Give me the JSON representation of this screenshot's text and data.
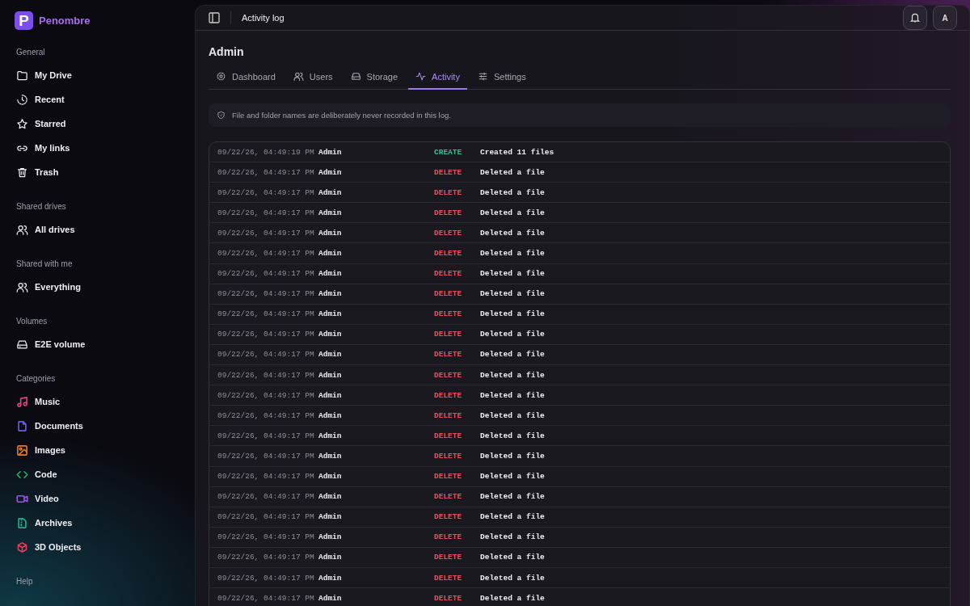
{
  "brand": {
    "name": "Penombre",
    "logo_letter": "P"
  },
  "sidebar": {
    "sections": [
      {
        "title": "General",
        "items": [
          {
            "label": "My Drive"
          },
          {
            "label": "Recent"
          },
          {
            "label": "Starred"
          },
          {
            "label": "My links"
          },
          {
            "label": "Trash"
          }
        ]
      },
      {
        "title": "Shared drives",
        "items": [
          {
            "label": "All drives"
          }
        ]
      },
      {
        "title": "Shared with me",
        "items": [
          {
            "label": "Everything"
          }
        ]
      },
      {
        "title": "Volumes",
        "items": [
          {
            "label": "E2E volume"
          }
        ]
      },
      {
        "title": "Categories",
        "items": [
          {
            "label": "Music",
            "color": "#e0407a"
          },
          {
            "label": "Documents",
            "color": "#6a5cf0"
          },
          {
            "label": "Images",
            "color": "#e8782a"
          },
          {
            "label": "Code",
            "color": "#22b45a"
          },
          {
            "label": "Video",
            "color": "#a050f0"
          },
          {
            "label": "Archives",
            "color": "#20b090"
          },
          {
            "label": "3D Objects",
            "color": "#e83c5c"
          }
        ]
      },
      {
        "title": "Help"
      }
    ]
  },
  "header": {
    "title": "Activity log",
    "avatar": "A"
  },
  "page": {
    "title": "Admin"
  },
  "tabs": [
    {
      "label": "Dashboard",
      "selected": false
    },
    {
      "label": "Users",
      "selected": false
    },
    {
      "label": "Storage",
      "selected": false
    },
    {
      "label": "Activity",
      "selected": true
    },
    {
      "label": "Settings",
      "selected": false
    }
  ],
  "notice": "File and folder names are deliberately never recorded in this log.",
  "log": [
    {
      "time": "09/22/26, 04:49:19 PM",
      "user": "Admin",
      "action": "CREATE",
      "kind": "create",
      "detail": "Created 11 files"
    },
    {
      "time": "09/22/26, 04:49:17 PM",
      "user": "Admin",
      "action": "DELETE",
      "kind": "delete",
      "detail": "Deleted a file"
    },
    {
      "time": "09/22/26, 04:49:17 PM",
      "user": "Admin",
      "action": "DELETE",
      "kind": "delete",
      "detail": "Deleted a file"
    },
    {
      "time": "09/22/26, 04:49:17 PM",
      "user": "Admin",
      "action": "DELETE",
      "kind": "delete",
      "detail": "Deleted a file"
    },
    {
      "time": "09/22/26, 04:49:17 PM",
      "user": "Admin",
      "action": "DELETE",
      "kind": "delete",
      "detail": "Deleted a file"
    },
    {
      "time": "09/22/26, 04:49:17 PM",
      "user": "Admin",
      "action": "DELETE",
      "kind": "delete",
      "detail": "Deleted a file"
    },
    {
      "time": "09/22/26, 04:49:17 PM",
      "user": "Admin",
      "action": "DELETE",
      "kind": "delete",
      "detail": "Deleted a file"
    },
    {
      "time": "09/22/26, 04:49:17 PM",
      "user": "Admin",
      "action": "DELETE",
      "kind": "delete",
      "detail": "Deleted a file"
    },
    {
      "time": "09/22/26, 04:49:17 PM",
      "user": "Admin",
      "action": "DELETE",
      "kind": "delete",
      "detail": "Deleted a file"
    },
    {
      "time": "09/22/26, 04:49:17 PM",
      "user": "Admin",
      "action": "DELETE",
      "kind": "delete",
      "detail": "Deleted a file"
    },
    {
      "time": "09/22/26, 04:49:17 PM",
      "user": "Admin",
      "action": "DELETE",
      "kind": "delete",
      "detail": "Deleted a file"
    },
    {
      "time": "09/22/26, 04:49:17 PM",
      "user": "Admin",
      "action": "DELETE",
      "kind": "delete",
      "detail": "Deleted a file"
    },
    {
      "time": "09/22/26, 04:49:17 PM",
      "user": "Admin",
      "action": "DELETE",
      "kind": "delete",
      "detail": "Deleted a file"
    },
    {
      "time": "09/22/26, 04:49:17 PM",
      "user": "Admin",
      "action": "DELETE",
      "kind": "delete",
      "detail": "Deleted a file"
    },
    {
      "time": "09/22/26, 04:49:17 PM",
      "user": "Admin",
      "action": "DELETE",
      "kind": "delete",
      "detail": "Deleted a file"
    },
    {
      "time": "09/22/26, 04:49:17 PM",
      "user": "Admin",
      "action": "DELETE",
      "kind": "delete",
      "detail": "Deleted a file"
    },
    {
      "time": "09/22/26, 04:49:17 PM",
      "user": "Admin",
      "action": "DELETE",
      "kind": "delete",
      "detail": "Deleted a file"
    },
    {
      "time": "09/22/26, 04:49:17 PM",
      "user": "Admin",
      "action": "DELETE",
      "kind": "delete",
      "detail": "Deleted a file"
    },
    {
      "time": "09/22/26, 04:49:17 PM",
      "user": "Admin",
      "action": "DELETE",
      "kind": "delete",
      "detail": "Deleted a file"
    },
    {
      "time": "09/22/26, 04:49:17 PM",
      "user": "Admin",
      "action": "DELETE",
      "kind": "delete",
      "detail": "Deleted a file"
    },
    {
      "time": "09/22/26, 04:49:17 PM",
      "user": "Admin",
      "action": "DELETE",
      "kind": "delete",
      "detail": "Deleted a file"
    },
    {
      "time": "09/22/26, 04:49:17 PM",
      "user": "Admin",
      "action": "DELETE",
      "kind": "delete",
      "detail": "Deleted a file"
    },
    {
      "time": "09/22/26, 04:49:17 PM",
      "user": "Admin",
      "action": "DELETE",
      "kind": "delete",
      "detail": "Deleted a file"
    }
  ]
}
